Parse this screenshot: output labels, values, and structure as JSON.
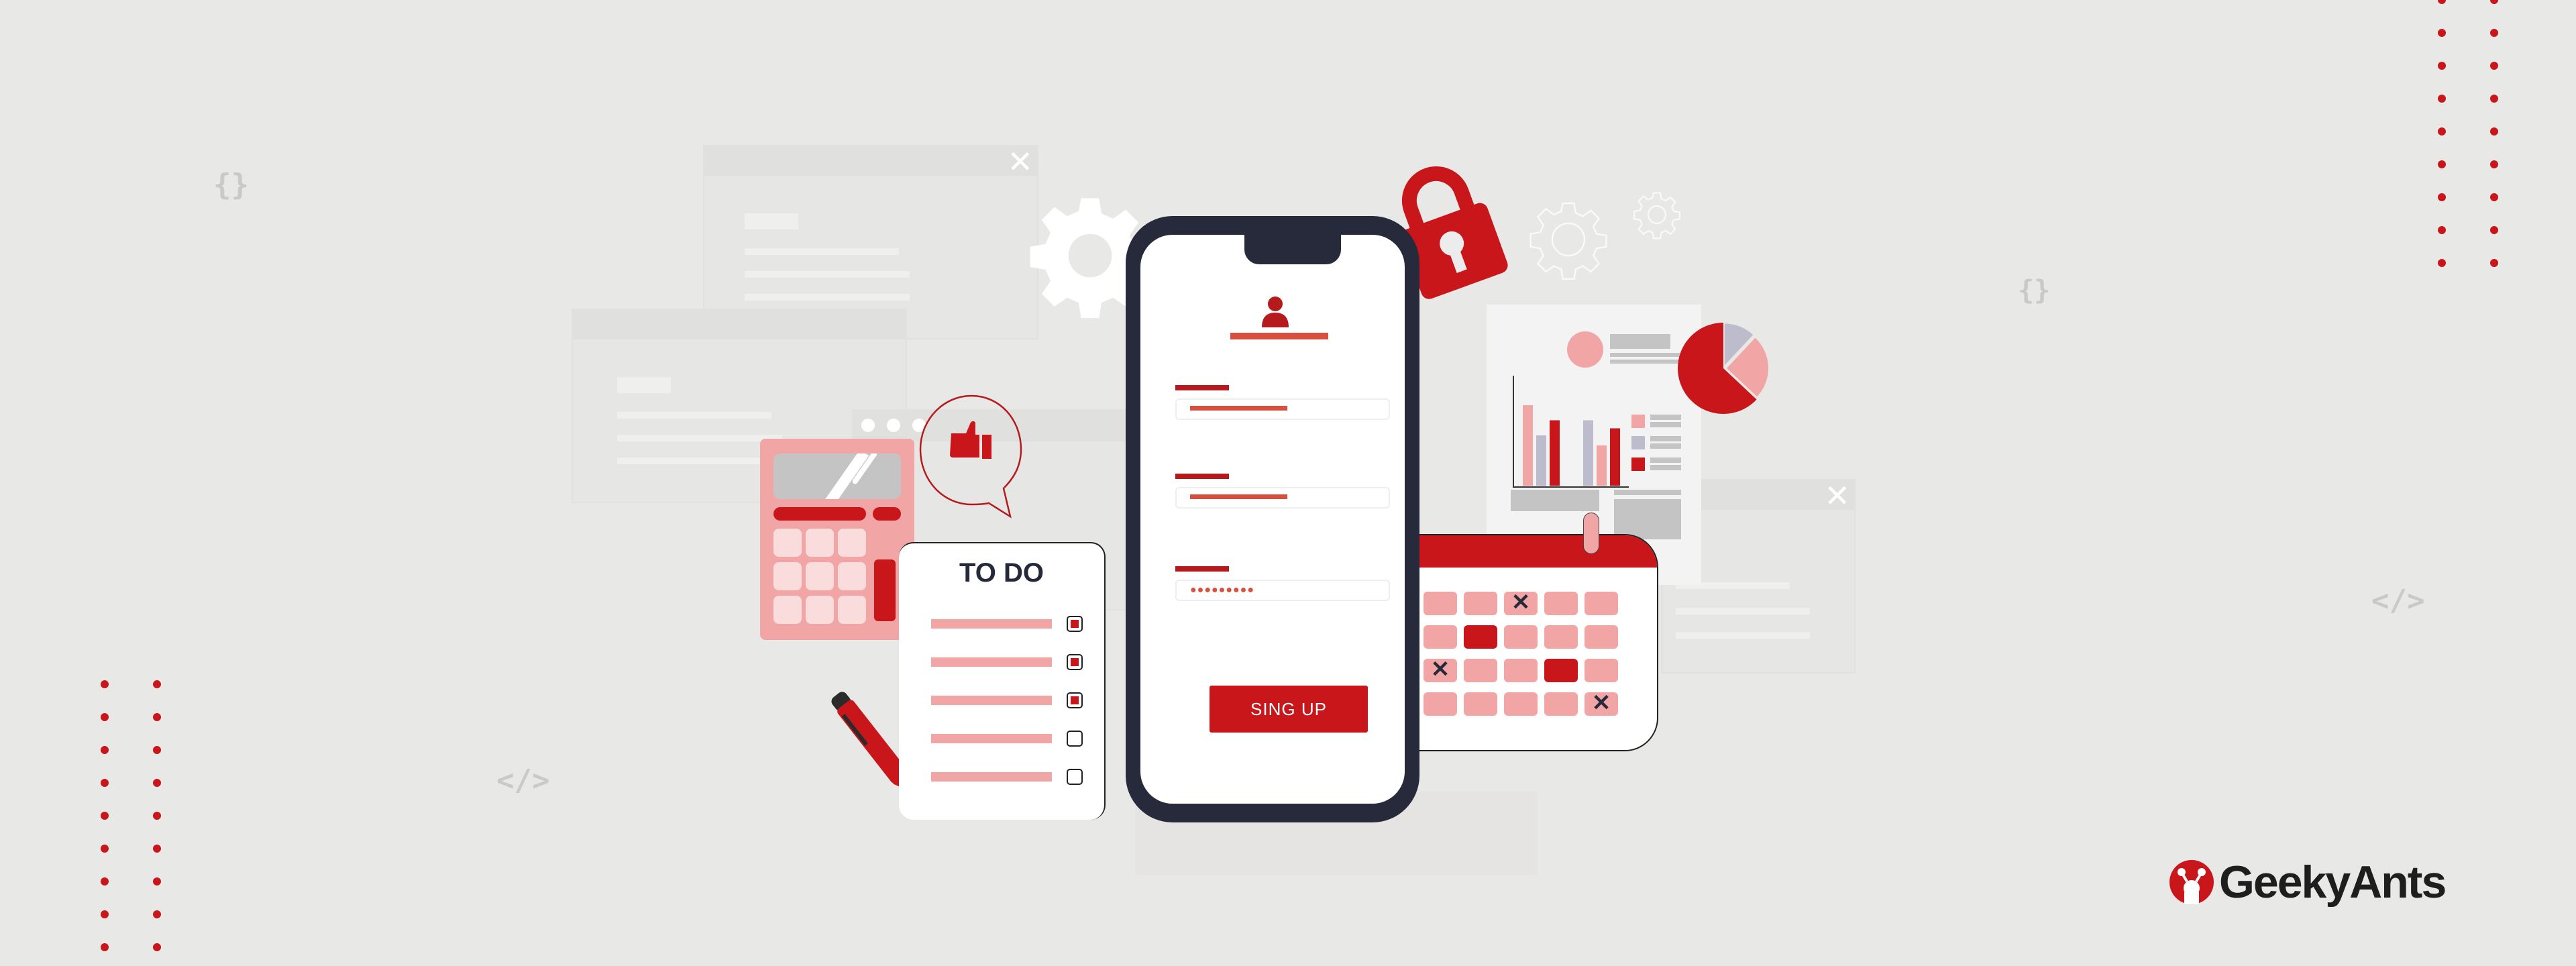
{
  "brand": {
    "name": "GeekyAnts",
    "logo_icon": "ant-logo-icon",
    "accent_color": "#c8161b",
    "dark_color": "#262a3b",
    "pink_color": "#f2a5a5",
    "background_color": "#e8e8e7"
  },
  "phone": {
    "profile_icon": "user-icon",
    "fields": [
      {
        "label_icon": "label-bar",
        "type": "text"
      },
      {
        "label_icon": "label-bar",
        "type": "text"
      },
      {
        "label_icon": "label-bar",
        "type": "password",
        "value": "●●●●●●●●●"
      }
    ],
    "submit_label": "SING UP"
  },
  "todo": {
    "title": "TO DO",
    "items": [
      {
        "checked": true
      },
      {
        "checked": true
      },
      {
        "checked": true
      },
      {
        "checked": false
      },
      {
        "checked": false
      }
    ]
  },
  "calendar": {
    "rows": [
      [
        "",
        "",
        "x",
        "",
        ""
      ],
      [
        "",
        "sel",
        "",
        "",
        ""
      ],
      [
        "x",
        "",
        "",
        "sel",
        ""
      ],
      [
        "",
        "",
        "",
        "",
        "x"
      ]
    ],
    "x_mark": "✕"
  },
  "decor": {
    "braces_glyph": "{}",
    "code_glyph": "</>",
    "close_glyph": "✕",
    "icons": [
      "gear-icon",
      "lock-icon",
      "thumbs-up-icon",
      "pen-icon",
      "pie-chart-icon",
      "bar-chart-icon",
      "calculator-icon"
    ]
  },
  "report_chart": {
    "bars_group1": [
      0.8,
      0.5,
      0.65
    ],
    "bars_group2": [
      0.65,
      0.4,
      0.57
    ],
    "pie_slices": [
      0.63,
      0.12,
      0.25
    ]
  }
}
